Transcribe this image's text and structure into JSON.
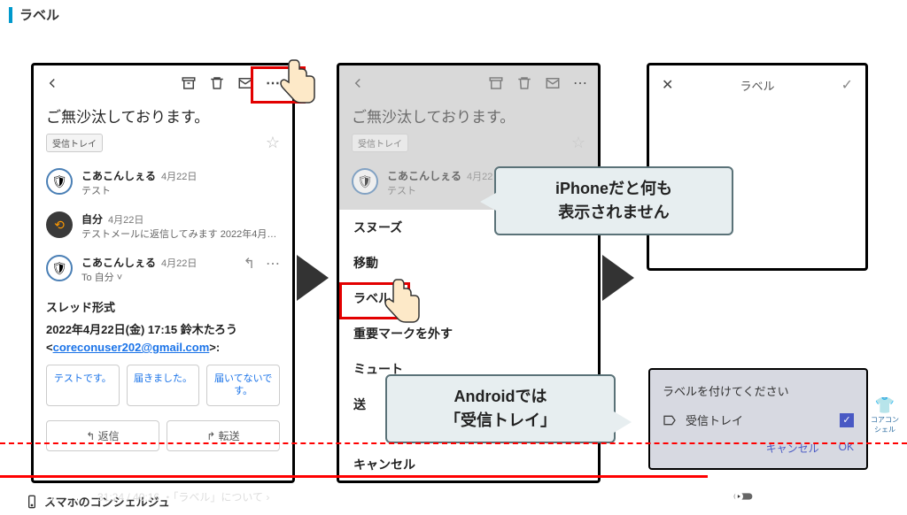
{
  "header": {
    "title": "ラベル"
  },
  "phone_left": {
    "email_title": "ご無沙汰しております。",
    "inbox_chip": "受信トレイ",
    "messages": [
      {
        "sender": "こあこんしぇる",
        "date": "4月22日",
        "preview": "テスト"
      },
      {
        "sender": "自分",
        "date": "4月22日",
        "preview": "テストメールに返信してみます 2022年4月…"
      },
      {
        "sender": "こあこんしぇる",
        "date": "4月22日",
        "preview": "To 自分 ˅"
      }
    ],
    "thread_label": "スレッド形式",
    "thread_date": "2022年4月22日(金) 17:15 鈴木たろう",
    "thread_email": "coreconuser202@gmail.com",
    "chips": [
      "テストです。",
      "届きました。",
      "届いてないです。"
    ],
    "reply": "↰ 返信",
    "forward": "↱ 転送"
  },
  "phone_center": {
    "email_title": "ご無沙汰しております。",
    "inbox_chip": "受信トレイ",
    "msg_sender": "こあこんしぇる",
    "msg_date": "4月22日",
    "msg_preview": "テスト",
    "menu": [
      "スヌーズ",
      "移動",
      "ラベル",
      "重要マークを外す",
      "ミュート",
      "送",
      "キャンセル"
    ]
  },
  "phone_right": {
    "title": "ラベル"
  },
  "callouts": {
    "iphone_line1": "iPhoneだと何も",
    "iphone_line2": "表示されません",
    "android_line1": "Androidでは",
    "android_line2": "「受信トレイ」"
  },
  "android_dialog": {
    "title": "ラベルを付けてください",
    "item": "受信トレイ",
    "cancel": "キャンセル",
    "ok": "OK"
  },
  "brand": "スマホのコンシェルジュ",
  "brand_right": "コアコンシェル",
  "video": {
    "time": "31:24 / 40:16",
    "chapter": "・「ラベル」について"
  }
}
